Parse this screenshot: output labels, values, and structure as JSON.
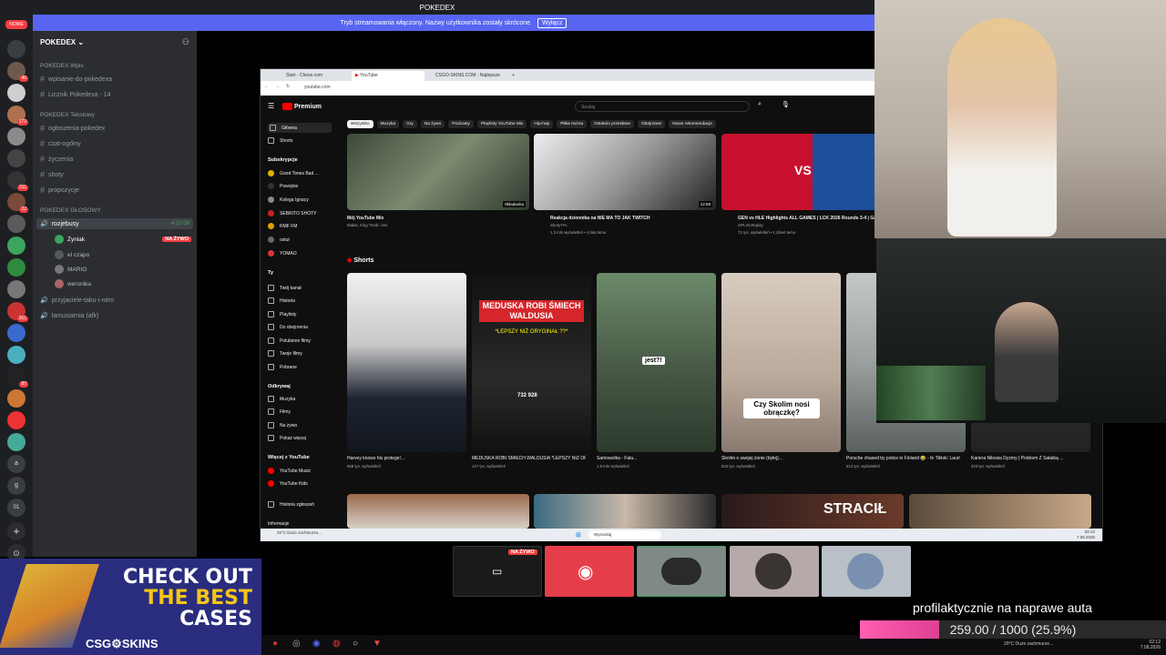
{
  "window": {
    "title": "POKEDEX"
  },
  "stream_banner": {
    "text": "Tryb streamowania włączony. Nazwy użytkownika zostały skrócone.",
    "button": "Wyłącz"
  },
  "rail": {
    "top_label": "NOWE",
    "badges": [
      "46",
      "172",
      "311",
      "22",
      "261",
      "87"
    ],
    "letters": [
      "a",
      "g",
      "01"
    ]
  },
  "server": {
    "name": "POKEDEX",
    "categories": [
      {
        "label": "POKEDEX Wpis",
        "channels": [
          "wpisanie-do-pokedexa",
          "Licznik Pokedexa - 14"
        ]
      },
      {
        "label": "POKEDEX Tekstowy",
        "channels": [
          "ogłoszenia-pokedex",
          "czat-ogólny",
          "życzenia",
          "shoty",
          "propozycje"
        ]
      },
      {
        "label": "POKEDEX GŁOSOWY"
      }
    ],
    "voice_channel": {
      "name": "rozjebusy",
      "timer": "4:22:08"
    },
    "voice_users": [
      "Żyniak",
      "el czapo",
      "MARIO",
      "weronika"
    ],
    "live_label": "NA ŻYWO",
    "other_voice": [
      "przyjaciele-taku-i-nitro",
      "lamusiarnia (afk)"
    ]
  },
  "browser": {
    "tabs": [
      "Start - Chess.com",
      "YouTube",
      "CSGO-SKINS.COM - Najlepsze"
    ],
    "url": "youtube.com"
  },
  "youtube": {
    "logo": "Premium",
    "search_placeholder": "Szukaj",
    "chips": [
      "Wszystko",
      "Muzyka",
      "Gry",
      "Na żywo",
      "Podcasty",
      "Playlisty YouTube Mix",
      "Hip-hop",
      "Piłka nożna",
      "Ostatnio przesłane",
      "Obejrzane",
      "Nowe rekomendacje"
    ],
    "side": {
      "main": [
        "Główna",
        "Shorts"
      ],
      "subs_header": "Subskrypcje",
      "subs": [
        "Good Times Bad ...",
        "Powojnie",
        "Kolega Ignacy",
        "SEBRITO SHOTY",
        "RMF FM",
        "ostuł",
        "YOMAO"
      ],
      "you_header": "Ty",
      "you": [
        "Twój kanał",
        "Historia",
        "Playlisty",
        "Do obejrzenia",
        "Polubione filmy",
        "Twoje filmy",
        "Pobrane"
      ],
      "explore_header": "Odkrywaj",
      "explore": [
        "Muzyka",
        "Filmy",
        "Na żywo",
        "Pokaż więcej"
      ],
      "more_header": "Więcej z YouTube",
      "more": [
        "YouTube Music",
        "YouTube Kids"
      ],
      "footer": [
        "Historia zgłoszeń",
        "Informacje"
      ]
    },
    "videos": [
      {
        "title": "Mój YouTube Mix",
        "meta": "Białas, King Tomb i inni",
        "badge": "Składanka"
      },
      {
        "title": "Reakcja dziennika na NIE MA TO JAK TWITCH",
        "meta": "ShotyYFL",
        "meta2": "1,3 mln wyświetleń • 4 lata temu",
        "duration": "12:59"
      },
      {
        "title": "GEN vs HLE Highlights ALL GAMES | LCK 2026 Rounds 3-4 | Gen.G vs Hanwha Life Esports",
        "meta": "OPLOLReplay",
        "meta2": "71 tys. wyświetleń • 1 dzień temu"
      }
    ],
    "shorts_header": "Shorts",
    "shorts": [
      {
        "title": "Harvey knows his protege!...",
        "views": "568 tys. wyświetleń"
      },
      {
        "title": "MEDUSKA ROBI ŚMIECH WALDUSIA *LEPSZY NIŻ ORYGINAŁ*...",
        "views": "147 tys. wyświetleń",
        "overlay": "MEDUSKA ROBI ŚMIECH WALDUSIA",
        "overlay2": "*LEPSZY NIŻ ORYGINAŁ ??*",
        "count": "732 928"
      },
      {
        "title": "Samowolka - Fala...",
        "views": "1,9 mln wyświetleń",
        "overlay": "jest?!"
      },
      {
        "title": "Skolim o swojej żonie (byłej)...",
        "views": "503 tys. wyświetleń",
        "overlay": "Czy Skolim nosi obrączkę?"
      },
      {
        "title": "Porsche chased by police in Finland 😂 - fe Tiktok: Lauriv03",
        "views": "613 tys. wyświetleń"
      },
      {
        "title": "Kariera Nikosia Dyzmy | Problem Z Sałatką ...",
        "views": "423 tys. wyświetleń"
      }
    ],
    "bottom_thumb_text": "STRACIŁ"
  },
  "win_taskbar": {
    "search": "Wyszukaj",
    "weather": "20°C Duże zachmurze...",
    "time": "02:12",
    "date": "7.08.2026"
  },
  "tiles": {
    "live_label": "NA ŻYWO"
  },
  "ad": {
    "line1": "CHECK OUT",
    "line2": "THE BEST",
    "line3": "CASES",
    "brand": "CSG⚙SKINS"
  },
  "goal": {
    "title": "profilaktycznie na naprawe auta",
    "current": 259,
    "target": 1000,
    "text": "259.00 / 1000 (25.9%)"
  },
  "host_taskbar": {
    "weather": "20°C Duże zachmurze...",
    "time": "02:12",
    "date": "7.08.2026"
  },
  "colors": {
    "discord_blurple": "#5865f2",
    "discord_red": "#f23f43",
    "youtube_red": "#ff0000",
    "goal_pink": "#e04094"
  }
}
